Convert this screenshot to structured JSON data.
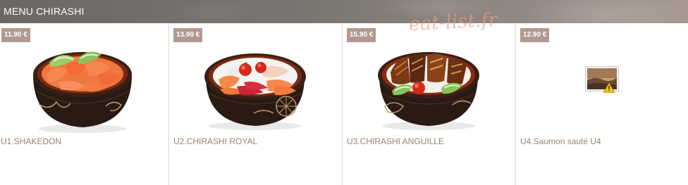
{
  "header": {
    "title": "MENU CHIRASHI"
  },
  "watermark": "eat-list.fr",
  "items": [
    {
      "code_name": "U1.SHAKEDON",
      "price": "11.90 €",
      "image": "salmon-bowl"
    },
    {
      "code_name": "U2.CHIRASHI ROYAL",
      "price": "13.90 €",
      "image": "mixed-sashimi-bowl"
    },
    {
      "code_name": "U3.CHIRASHI ANGUILLE",
      "price": "15.90 €",
      "image": "eel-bowl"
    },
    {
      "code_name": "U4.Saumon sauté U4",
      "price": "12.90 €",
      "image": "broken-image-icon"
    }
  ],
  "colors": {
    "header": "#7a7570",
    "badge": "#b09a90",
    "name_text": "#9a8074",
    "watermark": "#e8a082"
  }
}
